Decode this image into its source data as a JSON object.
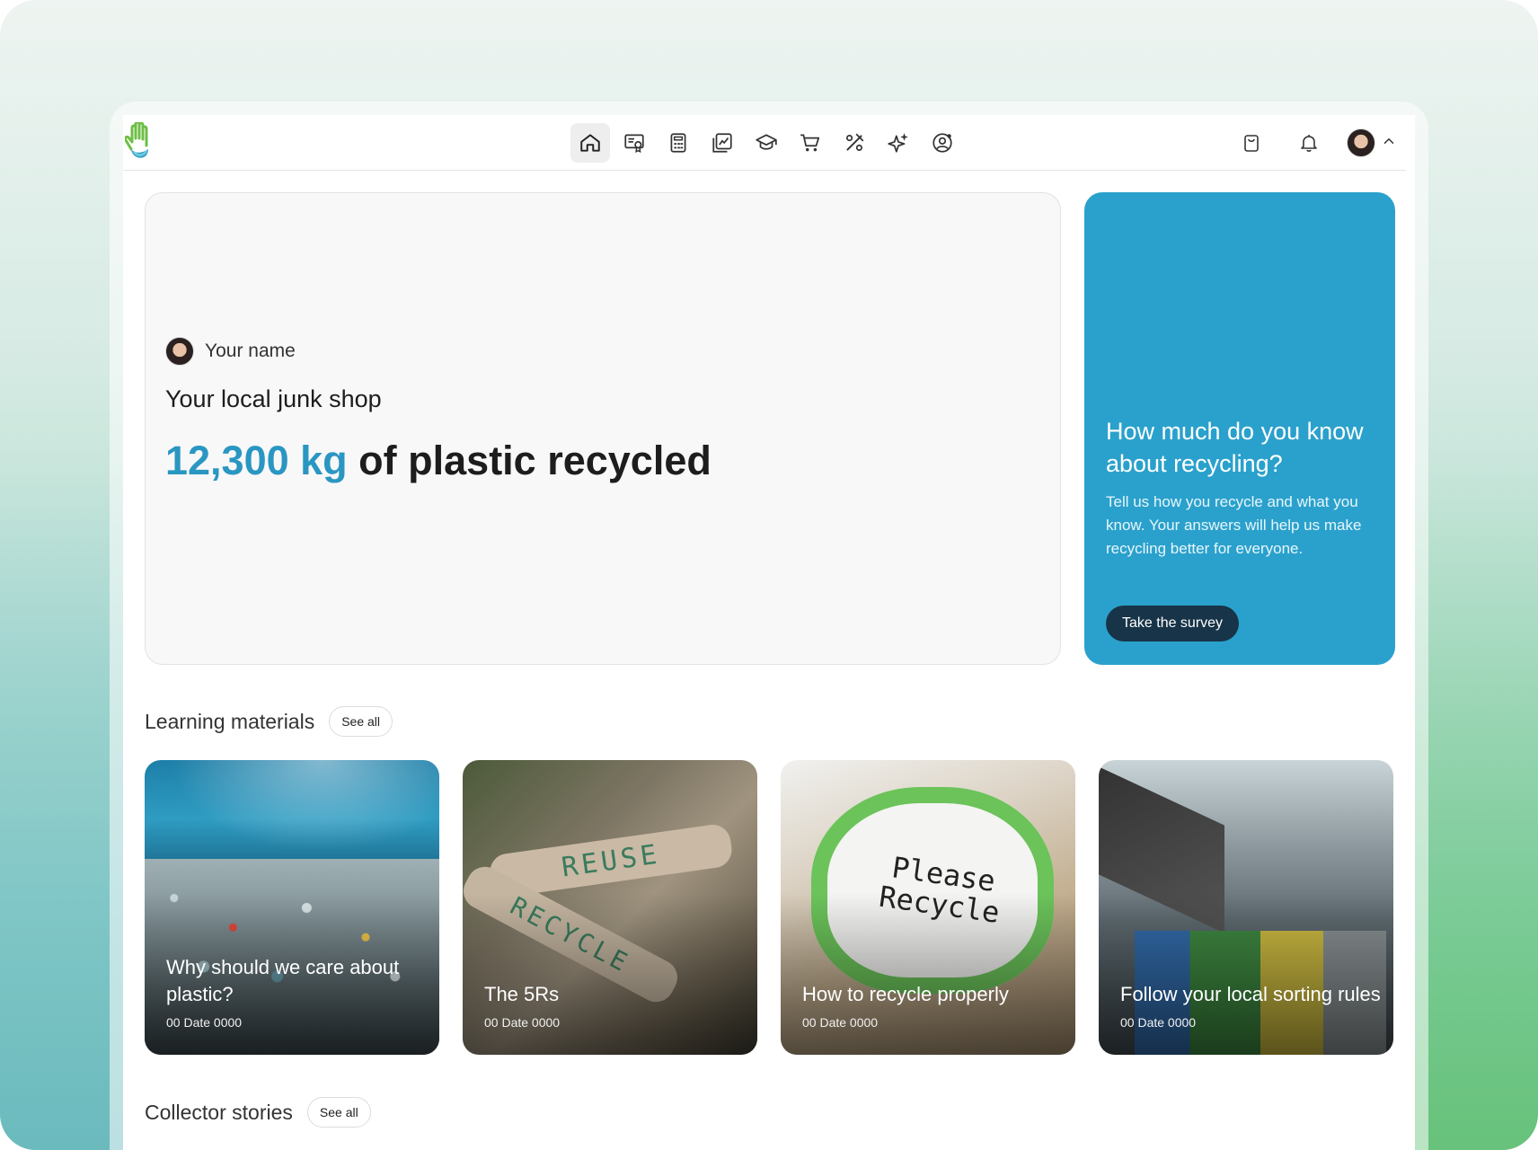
{
  "nav": {
    "items": [
      {
        "id": "home",
        "icon": "home-icon",
        "active": true
      },
      {
        "id": "billing",
        "icon": "certificate-icon",
        "active": false
      },
      {
        "id": "calculator",
        "icon": "calculator-icon",
        "active": false
      },
      {
        "id": "analytics",
        "icon": "chart-image-icon",
        "active": false
      },
      {
        "id": "learning",
        "icon": "graduation-cap-icon",
        "active": false
      },
      {
        "id": "shop",
        "icon": "cart-icon",
        "active": false
      },
      {
        "id": "promotions",
        "icon": "percent-tag-icon",
        "active": false
      },
      {
        "id": "ai",
        "icon": "sparkle-icon",
        "active": false
      },
      {
        "id": "account",
        "icon": "user-circle-icon",
        "active": false
      }
    ]
  },
  "header_tools": {
    "bag_icon": "bag-icon",
    "bell_icon": "bell-icon",
    "chevron_icon": "chevron-up-icon"
  },
  "hero": {
    "user_name": "Your name",
    "subtitle": "Your local junk shop",
    "stat_value": "12,300 kg",
    "stat_text": "of plastic recycled"
  },
  "survey": {
    "title": "How much do you know about recycling?",
    "body": "Tell us how you recycle and what you know. Your answers will help us make recycling better for everyone.",
    "button": "Take the survey"
  },
  "learning": {
    "title": "Learning materials",
    "see_all": "See all",
    "cards": [
      {
        "title": "Why should we care about plastic?",
        "date": "00 Date 0000"
      },
      {
        "title": "The 5Rs",
        "date": "00 Date 0000",
        "sign_top": "REUSE",
        "sign_bottom": "RECYCLE"
      },
      {
        "title": "How to recycle properly",
        "date": "00 Date 0000",
        "sticker": "Please Recycle"
      },
      {
        "title": "Follow your local sorting rules",
        "date": "00 Date 0000"
      }
    ]
  },
  "stories": {
    "title": "Collector stories",
    "see_all": "See all"
  },
  "colors": {
    "accent": "#2a96c2",
    "survey_bg": "#2aa1cc",
    "button_dark": "#183448"
  }
}
